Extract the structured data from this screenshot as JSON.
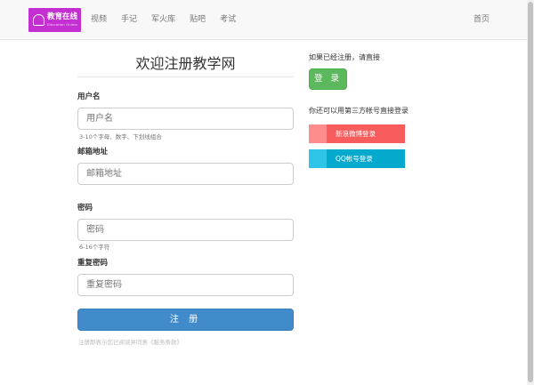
{
  "navbar": {
    "logo": {
      "title": "教育在线",
      "subtitle": "Education Online"
    },
    "items": [
      {
        "label": "视频"
      },
      {
        "label": "手记"
      },
      {
        "label": "军火库"
      },
      {
        "label": "贴吧"
      },
      {
        "label": "考试"
      }
    ],
    "right_link": "首页"
  },
  "form": {
    "title": "欢迎注册教学网",
    "username": {
      "label": "用户名",
      "placeholder": "用户名",
      "hint": "3-10个字母、数字、下划线组合"
    },
    "email": {
      "label": "邮箱地址",
      "placeholder": "邮箱地址"
    },
    "password": {
      "label": "密码",
      "placeholder": "密码",
      "hint": "6-16个字符"
    },
    "confirm": {
      "label": "重复密码",
      "placeholder": "重复密码"
    },
    "submit_label": "注 册",
    "terms": "注册即表示您已阅读并同意《服务条款》"
  },
  "side": {
    "already_registered": "如果已经注册，请直接",
    "login_label": "登 录",
    "third_party_prompt": "你还可以用第三方帐号直接登录",
    "weibo_label": "新浪微博登录",
    "qq_label": "QQ帐号登录"
  },
  "colors": {
    "logo_bg": "#c32fd0",
    "primary": "#428bca",
    "success": "#5cb85c",
    "weibo": "#f95c5c",
    "qq": "#04aacd"
  }
}
